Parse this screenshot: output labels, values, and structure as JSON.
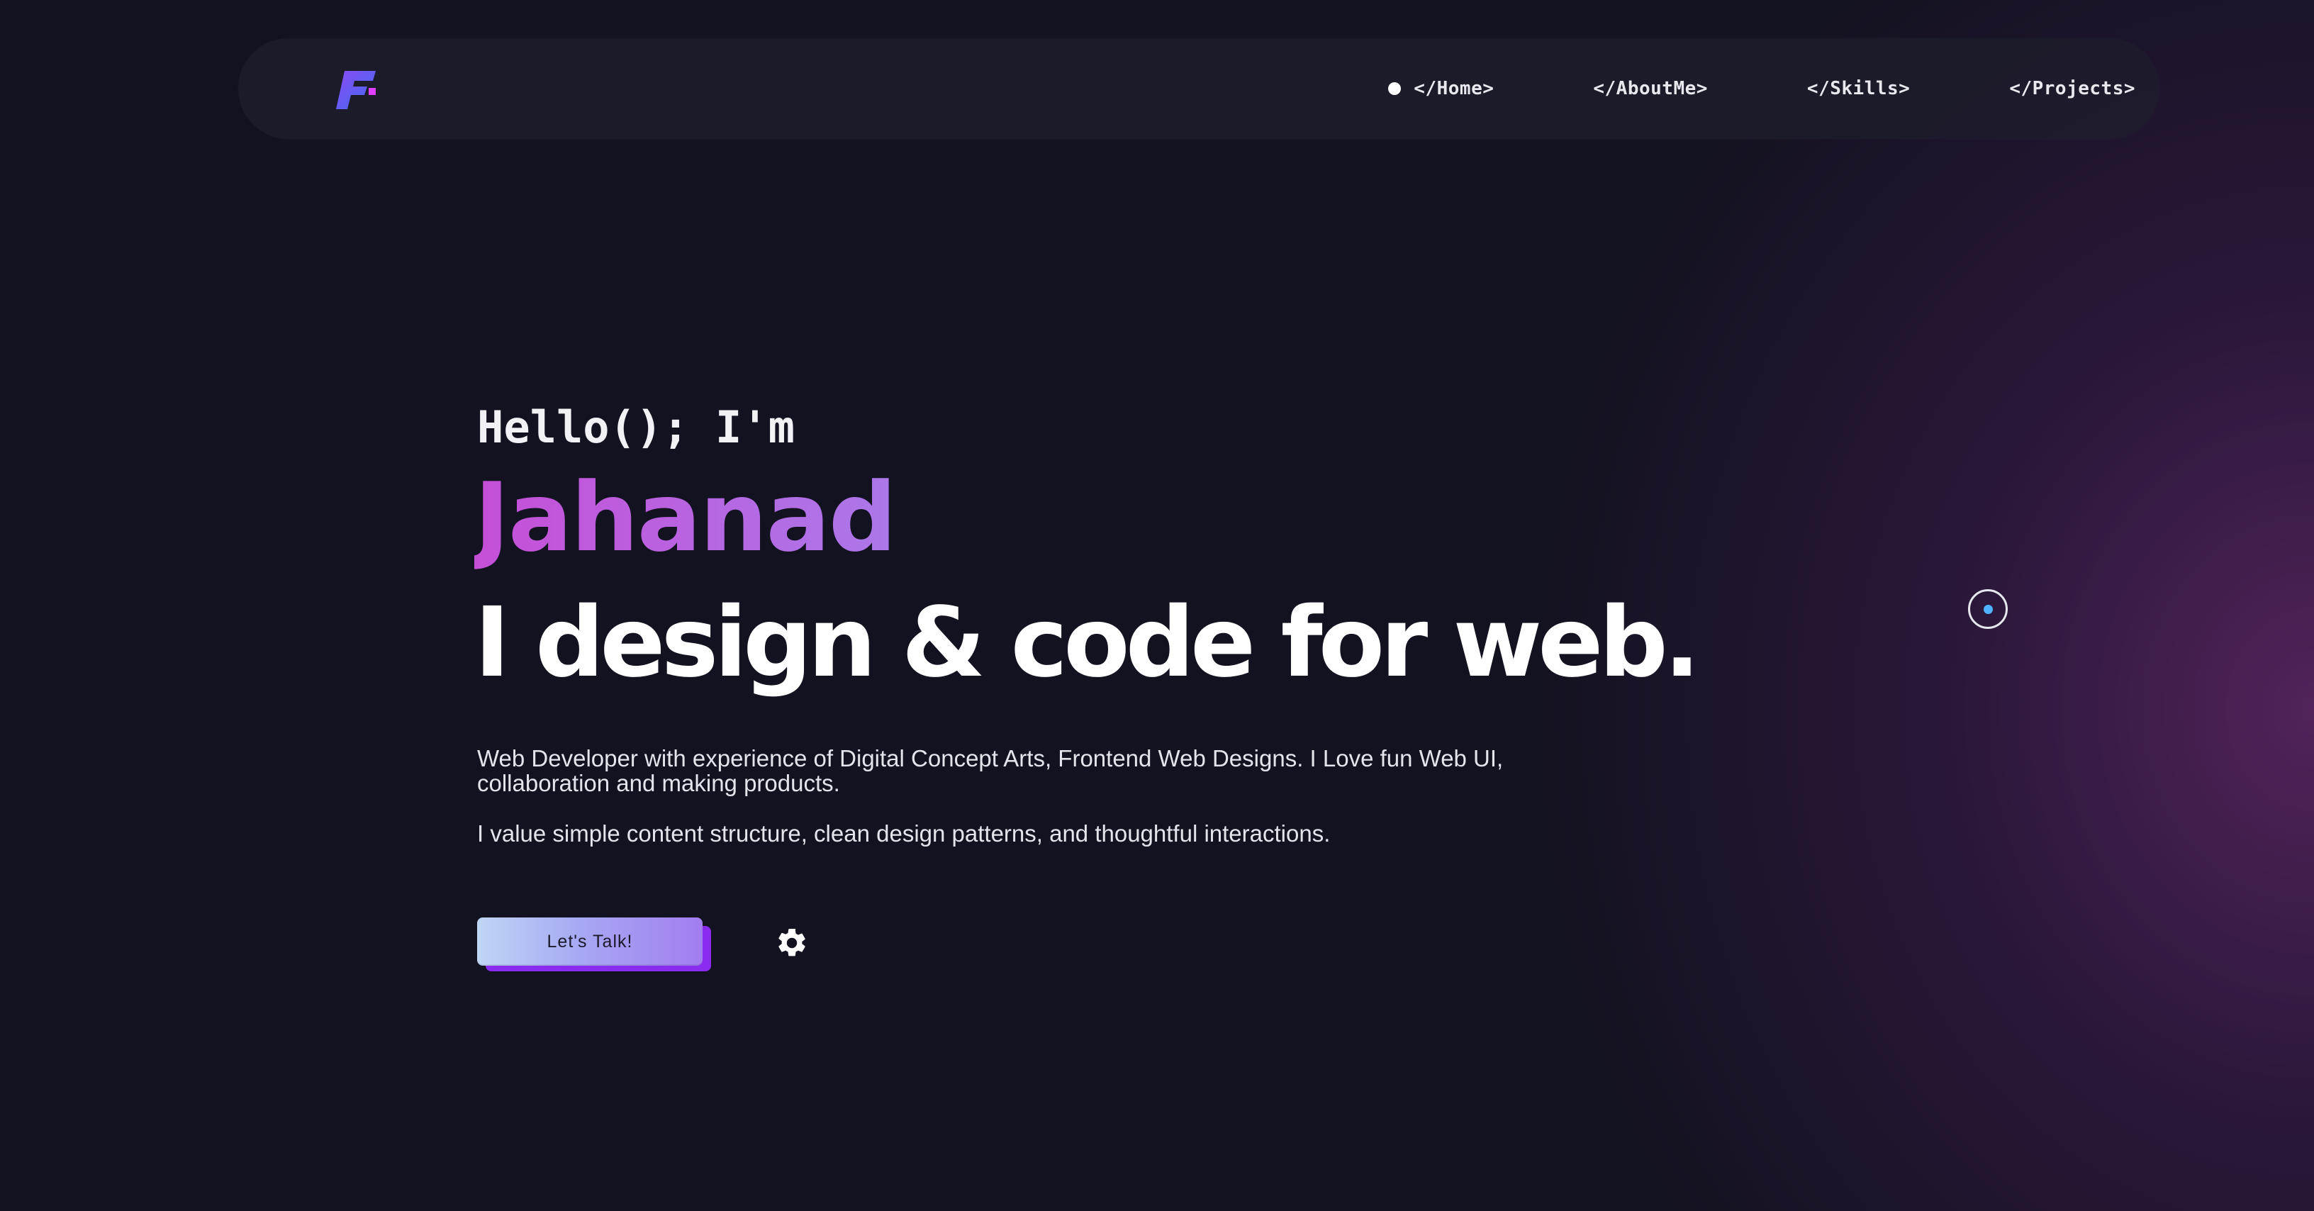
{
  "nav": {
    "logo_icon": "f-logo-icon",
    "items": [
      {
        "label": "</Home>",
        "active": true
      },
      {
        "label": "</AboutMe>",
        "active": false
      },
      {
        "label": "</Skills>",
        "active": false
      },
      {
        "label": "</Projects>",
        "active": false
      }
    ]
  },
  "hero": {
    "greeting": "Hello(); I'm",
    "name": "Jahanad",
    "tagline": "I design & code for web.",
    "bio": "Web Developer with experience of Digital Concept Arts, Frontend Web Designs. I Love fun Web UI, collaboration and making products.",
    "bio2": "I value simple content structure, clean design patterns, and thoughtful interactions."
  },
  "cta": {
    "label": "Let's Talk!",
    "settings_icon": "gear-icon"
  },
  "cursor": {
    "icon": "cursor-ring-icon"
  },
  "colors": {
    "background": "#131220",
    "accent_purple": "#8a2cf0",
    "name_gradient_start": "#c64fd8",
    "name_gradient_end": "#8a9af5",
    "cursor_dot": "#4fb3ff"
  }
}
